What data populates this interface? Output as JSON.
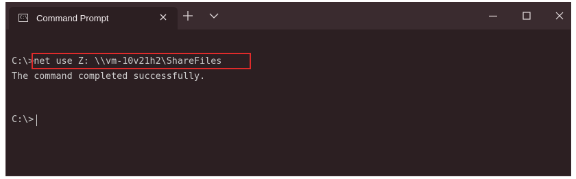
{
  "tab": {
    "title": "Command Prompt",
    "icon": "command-prompt-icon",
    "icon_text": "C:\\"
  },
  "titlebar": {
    "new_tab_icon": "plus-icon",
    "dropdown_icon": "chevron-down-icon",
    "window_controls": [
      "minimize-icon",
      "maximize-icon",
      "close-icon"
    ]
  },
  "terminal": {
    "prompt1": "C:\\>",
    "command": "net use Z: \\\\vm-10v21h2\\ShareFiles",
    "output": "The command completed successfully.",
    "prompt2": "C:\\>"
  },
  "colors": {
    "background": "#2c1f22",
    "titlebar": "#3a2b2f",
    "text": "#cccccc",
    "highlight_border": "#e02b2b"
  }
}
